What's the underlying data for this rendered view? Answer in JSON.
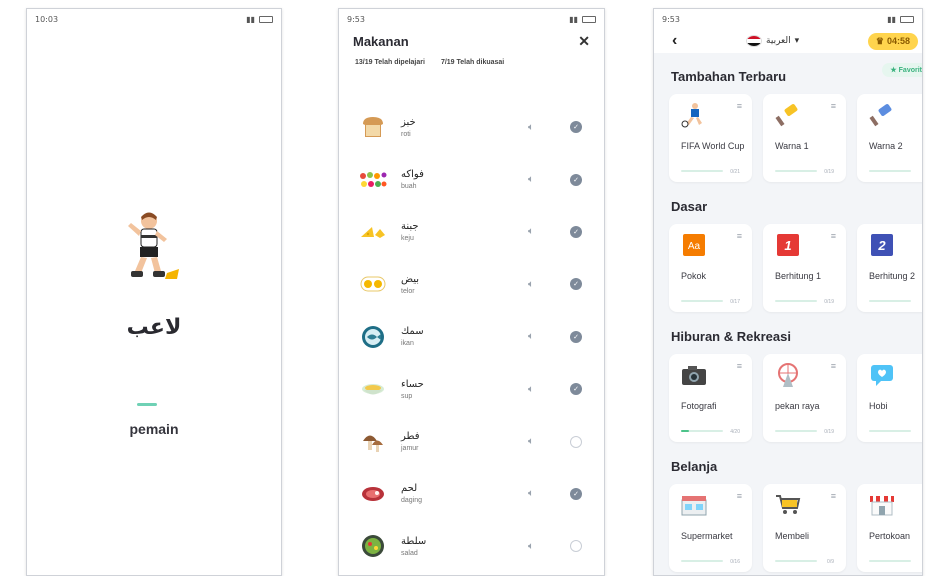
{
  "phone1": {
    "status_time": "10:03",
    "word_ar": "لاعب",
    "word_id": "pemain"
  },
  "phone2": {
    "status_time": "9:53",
    "title": "Makanan",
    "close": "✕",
    "learned_count": "13/19",
    "learned_label": "Telah dipelajari",
    "mastered_count": "7/19",
    "mastered_label": "Telah dikuasai",
    "items": [
      {
        "ar": "خبز",
        "id": "roti",
        "icon": "bread-icon",
        "mastered": true
      },
      {
        "ar": "فواكه",
        "id": "buah",
        "icon": "fruits-icon",
        "mastered": true
      },
      {
        "ar": "جبنة",
        "id": "keju",
        "icon": "cheese-icon",
        "mastered": true
      },
      {
        "ar": "بيض",
        "id": "telor",
        "icon": "egg-icon",
        "mastered": true
      },
      {
        "ar": "سمك",
        "id": "ikan",
        "icon": "fish-icon",
        "mastered": true
      },
      {
        "ar": "حساء",
        "id": "sup",
        "icon": "soup-icon",
        "mastered": true
      },
      {
        "ar": "فطر",
        "id": "jamur",
        "icon": "mushroom-icon",
        "mastered": false
      },
      {
        "ar": "لحم",
        "id": "daging",
        "icon": "meat-icon",
        "mastered": true
      },
      {
        "ar": "سلطة",
        "id": "salad",
        "icon": "salad-icon",
        "mastered": false
      }
    ]
  },
  "phone3": {
    "status_time": "9:53",
    "language": "العربية",
    "timer": "04:58",
    "favorite_label": "Favorit",
    "sections": [
      {
        "title": "Tambahan Terbaru",
        "cards": [
          {
            "title": "FIFA World Cup",
            "count": "0/21",
            "icon": "soccer-player-icon",
            "progress": 0
          },
          {
            "title": "Warna 1",
            "count": "0/19",
            "icon": "paintbrush-icon",
            "progress": 0
          },
          {
            "title": "Warna 2",
            "count": "0/",
            "icon": "paintbrush-blue-icon",
            "progress": 0
          }
        ]
      },
      {
        "title": "Dasar",
        "cards": [
          {
            "title": "Pokok",
            "count": "0/17",
            "icon": "alphabet-icon",
            "progress": 0
          },
          {
            "title": "Berhitung 1",
            "count": "0/19",
            "icon": "number-one-icon",
            "progress": 0
          },
          {
            "title": "Berhitung 2",
            "count": "",
            "icon": "number-two-icon",
            "progress": 0
          }
        ]
      },
      {
        "title": "Hiburan & Rekreasi",
        "cards": [
          {
            "title": "Fotografi",
            "count": "4/20",
            "icon": "camera-icon",
            "progress": 0.2
          },
          {
            "title": "pekan raya",
            "count": "0/19",
            "icon": "ferris-wheel-icon",
            "progress": 0
          },
          {
            "title": "Hobi",
            "count": "0/",
            "icon": "chat-heart-icon",
            "progress": 0
          }
        ]
      },
      {
        "title": "Belanja",
        "cards": [
          {
            "title": "Supermarket",
            "count": "0/16",
            "icon": "supermarket-icon",
            "progress": 0
          },
          {
            "title": "Membeli",
            "count": "0/9",
            "icon": "shopping-cart-icon",
            "progress": 0
          },
          {
            "title": "Pertokoan",
            "count": "",
            "icon": "storefront-icon",
            "progress": 0
          }
        ]
      }
    ]
  }
}
